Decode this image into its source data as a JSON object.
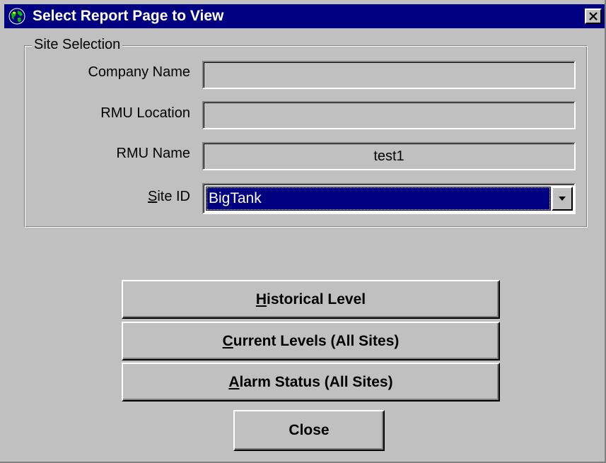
{
  "window": {
    "title": "Select Report Page to View",
    "icon": "globe-icon",
    "close_icon": "close-icon"
  },
  "site_selection": {
    "legend": "Site Selection",
    "company_name": {
      "label": "Company Name",
      "value": ""
    },
    "rmu_location": {
      "label": "RMU Location",
      "value": ""
    },
    "rmu_name": {
      "label": "RMU Name",
      "value": "test1"
    },
    "site_id": {
      "label_mnemonic": "S",
      "label_rest": "ite ID",
      "value": "BigTank",
      "dropdown_icon": "chevron-down-icon"
    }
  },
  "buttons": {
    "historical": {
      "mnemonic": "H",
      "rest": "istorical Level"
    },
    "current": {
      "mnemonic": "C",
      "rest": "urrent Levels (All Sites)"
    },
    "alarm": {
      "mnemonic": "A",
      "rest": "larm Status (All Sites)"
    },
    "close": {
      "label": "Close"
    }
  },
  "colors": {
    "face": "#c0c0c0",
    "titlebar": "#000080",
    "selection": "#000080",
    "text": "#000000",
    "selected_text": "#ffffff"
  }
}
